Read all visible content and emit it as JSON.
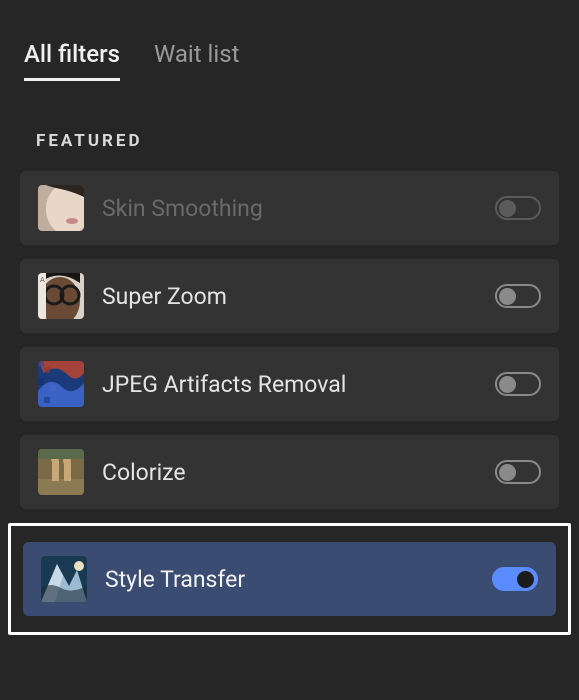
{
  "tabs": {
    "all_filters": "All filters",
    "wait_list": "Wait list"
  },
  "section_title": "FEATURED",
  "filters": [
    {
      "label": "Skin Smoothing",
      "enabled": false,
      "disabled_row": true,
      "selected": false,
      "icon": "skin-smoothing-thumb"
    },
    {
      "label": "Super Zoom",
      "enabled": false,
      "disabled_row": false,
      "selected": false,
      "icon": "super-zoom-thumb"
    },
    {
      "label": "JPEG Artifacts Removal",
      "enabled": false,
      "disabled_row": false,
      "selected": false,
      "icon": "jpeg-artifacts-thumb"
    },
    {
      "label": "Colorize",
      "enabled": false,
      "disabled_row": false,
      "selected": false,
      "icon": "colorize-thumb"
    },
    {
      "label": "Style Transfer",
      "enabled": true,
      "disabled_row": false,
      "selected": true,
      "icon": "style-transfer-thumb"
    }
  ]
}
